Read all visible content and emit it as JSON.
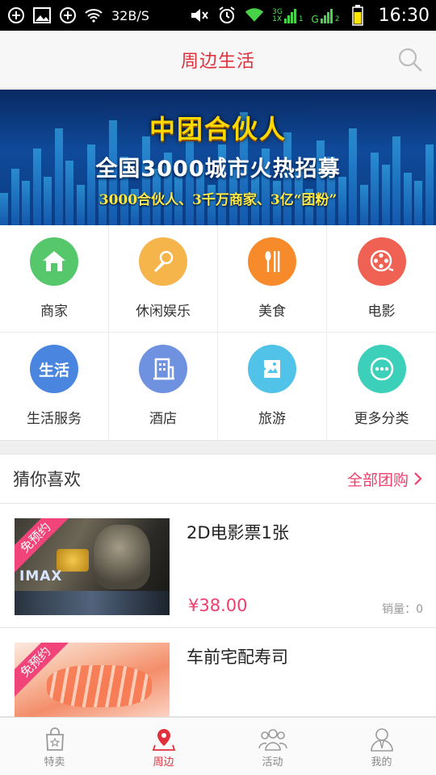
{
  "status_bar": {
    "speed": "32B/S",
    "network_3g": "3G",
    "network_1x": "1X",
    "sim1": "1",
    "network_g": "G",
    "sim2": "2",
    "time": "16:30"
  },
  "header": {
    "title": "周边生活",
    "search_icon": "search-icon"
  },
  "banner": {
    "line1": "中团合伙人",
    "line2": "全国3000城市火热招募",
    "line3": "3000合伙人、3千万商家、3亿“团粉”"
  },
  "categories": [
    {
      "label": "商家",
      "icon": "home-icon",
      "color": "#56c86b"
    },
    {
      "label": "休闲娱乐",
      "icon": "microphone-icon",
      "color": "#f6b54b"
    },
    {
      "label": "美食",
      "icon": "fork-knife-icon",
      "color": "#f78a2b"
    },
    {
      "label": "电影",
      "icon": "film-reel-icon",
      "color": "#ef6152"
    },
    {
      "label": "生活服务",
      "icon": "life-service-icon",
      "icon_text": "生活",
      "color": "#4a86e0"
    },
    {
      "label": "酒店",
      "icon": "hotel-building-icon",
      "color": "#6f92e0"
    },
    {
      "label": "旅游",
      "icon": "travel-ticket-icon",
      "color": "#52c3e8"
    },
    {
      "label": "更多分类",
      "icon": "more-dots-icon",
      "color": "#3ccfb9"
    }
  ],
  "guess": {
    "title": "猜你喜欢",
    "all_label": "全部团购"
  },
  "deals": [
    {
      "title": "2D电影票1张",
      "price": "¥38.00",
      "sales": "销量：0",
      "badge": "免预约",
      "image_caption": "IMAX"
    },
    {
      "title": "车前宅配寿司",
      "badge": "免预约"
    }
  ],
  "tabs": [
    {
      "label": "特卖",
      "icon": "shopping-bag-icon",
      "active": false
    },
    {
      "label": "周边",
      "icon": "location-pin-icon",
      "active": true
    },
    {
      "label": "活动",
      "icon": "group-people-icon",
      "active": false
    },
    {
      "label": "我的",
      "icon": "user-profile-icon",
      "active": false
    }
  ],
  "colors": {
    "brand_red": "#e0303c",
    "accent_pink": "#f03f6c"
  }
}
